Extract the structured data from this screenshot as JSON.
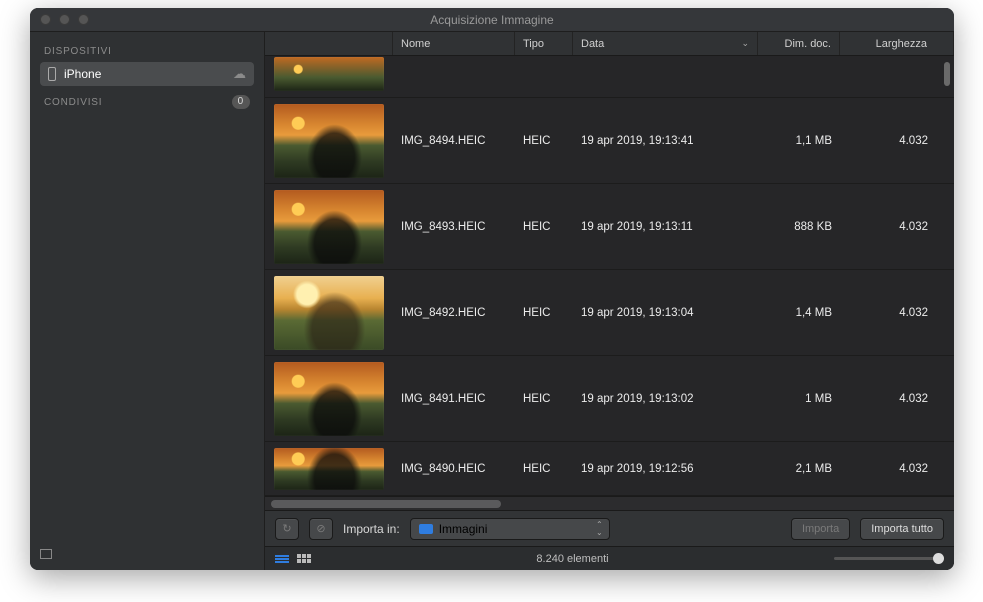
{
  "window": {
    "title": "Acquisizione Immagine"
  },
  "sidebar": {
    "sections": [
      {
        "label": "DISPOSITIVI",
        "items": [
          {
            "name": "iPhone",
            "selected": true
          }
        ]
      },
      {
        "label": "CONDIVISI",
        "badge": "0",
        "items": []
      }
    ]
  },
  "columns": {
    "name": "Nome",
    "type": "Tipo",
    "date": "Data",
    "size": "Dim. doc.",
    "width": "Larghezza"
  },
  "rows": [
    {
      "name": "IMG_8494.HEIC",
      "type": "HEIC",
      "date": "19 apr 2019, 19:13:41",
      "size": "1,1 MB",
      "width": "4.032"
    },
    {
      "name": "IMG_8493.HEIC",
      "type": "HEIC",
      "date": "19 apr 2019, 19:13:11",
      "size": "888 KB",
      "width": "4.032"
    },
    {
      "name": "IMG_8492.HEIC",
      "type": "HEIC",
      "date": "19 apr 2019, 19:13:04",
      "size": "1,4 MB",
      "width": "4.032",
      "bright": true
    },
    {
      "name": "IMG_8491.HEIC",
      "type": "HEIC",
      "date": "19 apr 2019, 19:13:02",
      "size": "1 MB",
      "width": "4.032"
    },
    {
      "name": "IMG_8490.HEIC",
      "type": "HEIC",
      "date": "19 apr 2019, 19:12:56",
      "size": "2,1 MB",
      "width": "4.032"
    }
  ],
  "toolbar": {
    "import_label": "Importa in:",
    "destination": "Immagini",
    "import_btn": "Importa",
    "import_all_btn": "Importa tutto"
  },
  "status": {
    "count": "8.240 elementi"
  }
}
